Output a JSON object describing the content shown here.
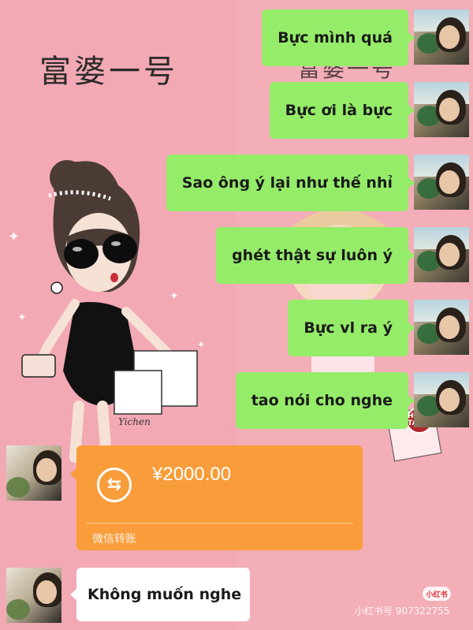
{
  "background": {
    "title_left": "富婆一号",
    "title_right": "富婆一号",
    "signature": "Yichen",
    "seal_text": "HĐ TAU"
  },
  "sent_messages": [
    "Bực mình quá",
    "Bực ơi là bực",
    "Sao ông ý lại như thế nhỉ",
    "ghét thật sự luôn ý",
    "Bực vl ra ý",
    "tao nói cho nghe"
  ],
  "transfer": {
    "amount": "¥2000.00",
    "label": "微信转账",
    "icon": "transfer-arrows-icon"
  },
  "received_message": "Không muốn nghe",
  "watermark": {
    "logo": "小红书",
    "text": "小红书号 907322755"
  },
  "colors": {
    "sent_bubble": "#95ec69",
    "transfer_card": "#f89d3a",
    "background": "#f2a9b4"
  }
}
